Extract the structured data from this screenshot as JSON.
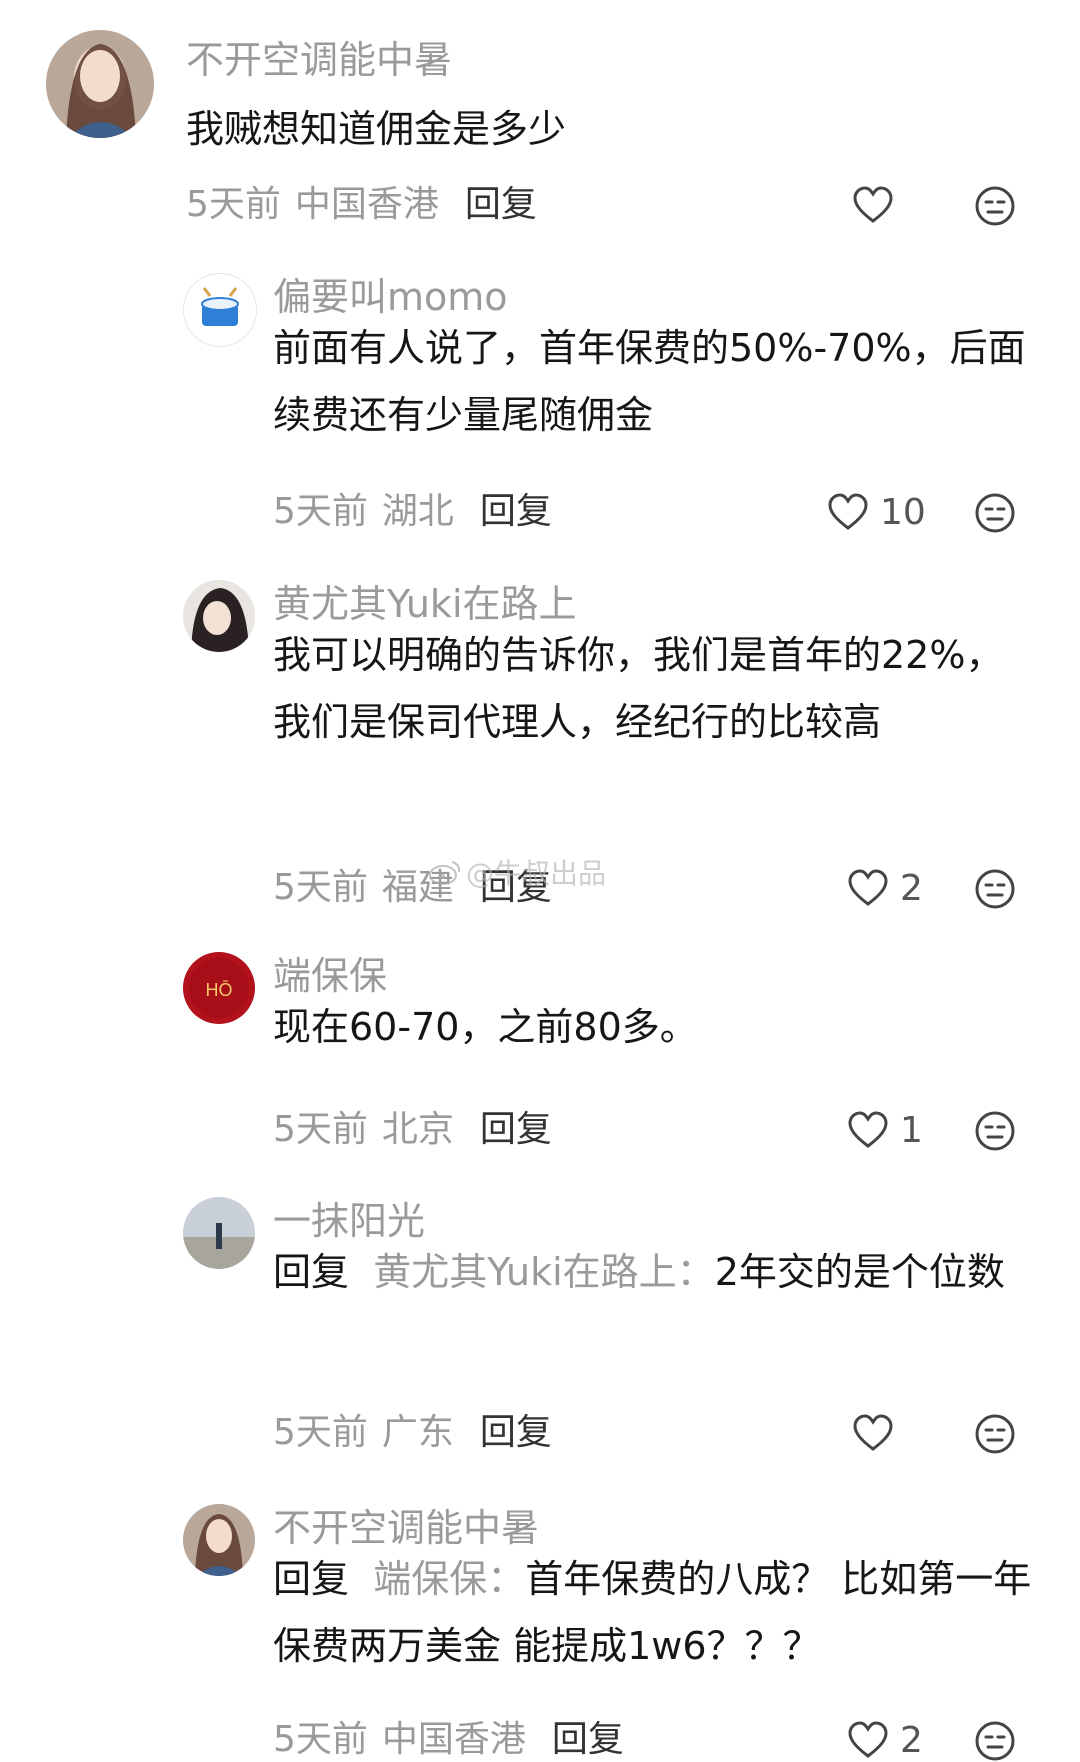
{
  "comments": [
    {
      "username": "不开空调能中暑",
      "content": "我贼想知道佣金是多少",
      "time": "5天前",
      "location": "中国香港",
      "reply_label": "回复",
      "likes": ""
    },
    {
      "username": "偏要叫momo",
      "content": "前面有人说了，首年保费的50%-70%，后面续费还有少量尾随佣金",
      "time": "5天前",
      "location": "湖北",
      "reply_label": "回复",
      "likes": "10"
    },
    {
      "username": "黄尤其Yuki在路上",
      "content": "我可以明确的告诉你，我们是首年的22%，我们是保司代理人，经纪行的比较高",
      "time": "5天前",
      "location": "福建",
      "reply_label": "回复",
      "likes": "2"
    },
    {
      "username": "端保保",
      "content": "现在60-70，之前80多。",
      "time": "5天前",
      "location": "北京",
      "reply_label": "回复",
      "likes": "1"
    },
    {
      "username": "一抹阳光",
      "reply_prefix": "回复",
      "mention": "黄尤其Yuki在路上：",
      "content": "2年交的是个位数",
      "time": "5天前",
      "location": "广东",
      "reply_label": "回复",
      "likes": ""
    },
    {
      "username": "不开空调能中暑",
      "reply_prefix": "回复",
      "mention": "端保保：",
      "content": "首年保费的八成？ 比如第一年保费两万美金 能提成1w6？？？",
      "time": "5天前",
      "location": "中国香港",
      "reply_label": "回复",
      "likes": "2"
    }
  ],
  "watermark": "@牛叔出品",
  "colors": {
    "text": "#161616",
    "muted": "#9a9a9a",
    "bg": "#ffffff"
  }
}
